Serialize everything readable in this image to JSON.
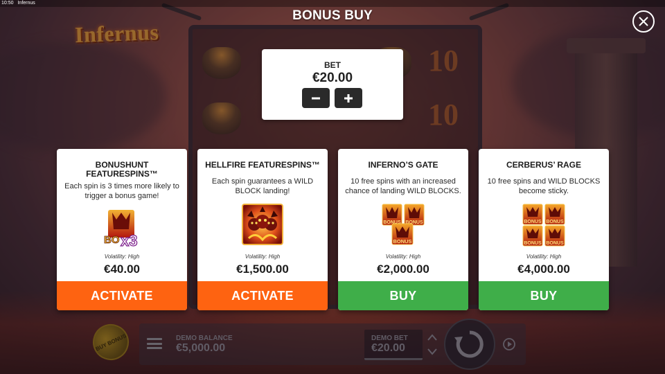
{
  "status_bar": {
    "time": "10:50",
    "app_name": "Infernus"
  },
  "game_logo": "Infernus",
  "modal": {
    "title": "BONUS BUY",
    "close_icon": "close-icon"
  },
  "bet": {
    "label": "BET",
    "value": "€20.00",
    "decrease_icon": "minus-icon",
    "increase_icon": "plus-icon"
  },
  "cards": [
    {
      "title": "BONUSHUNT FEATURESPINS™",
      "description": "Each spin is 3 times more likely to trigger a bonus game!",
      "art_icon": "bonus-x3-icon",
      "art_text_1": "BO",
      "art_text_2": "x3",
      "volatility": "Volatility: High",
      "price": "€40.00",
      "button_label": "ACTIVATE",
      "button_color": "#fe6311"
    },
    {
      "title": "HELLFIRE FEATURESPINS™",
      "description": "Each spin guarantees a WILD BLOCK landing!",
      "art_icon": "cerberus-wild-icon",
      "volatility": "Volatility: High",
      "price": "€1,500.00",
      "button_label": "ACTIVATE",
      "button_color": "#fe6311"
    },
    {
      "title": "INFERNO’S GATE",
      "description": "10 free spins with an increased chance of landing WILD BLOCKS.",
      "art_icon": "three-bonus-symbols-icon",
      "art_text": "BONUS",
      "volatility": "Volatility: High",
      "price": "€2,000.00",
      "button_label": "BUY",
      "button_color": "#3fae49"
    },
    {
      "title": "CERBERUS’ RAGE",
      "description": "10 free spins and WILD BLOCKS become sticky.",
      "art_icon": "four-bonus-symbols-icon",
      "art_text": "BONUS",
      "volatility": "Volatility: High",
      "price": "€4,000.00",
      "button_label": "BUY",
      "button_color": "#3fae49"
    }
  ],
  "hud": {
    "buy_bonus_label": "BUY BONUS",
    "menu_icon": "hamburger-menu-icon",
    "demo_balance_label": "DEMO BALANCE",
    "demo_balance_value": "€5,000.00",
    "demo_bet_label": "DEMO BET",
    "demo_bet_value": "€20.00",
    "bet_up_icon": "chevron-up-icon",
    "bet_down_icon": "chevron-down-icon",
    "spin_icon": "spin-arrow-icon",
    "autoplay_icon": "autoplay-icon"
  },
  "reel_symbol_text": [
    "10",
    "10",
    "10",
    "10"
  ],
  "colors": {
    "activate": "#fe6311",
    "buy": "#3fae49",
    "panel_bg": "#ffffff"
  }
}
